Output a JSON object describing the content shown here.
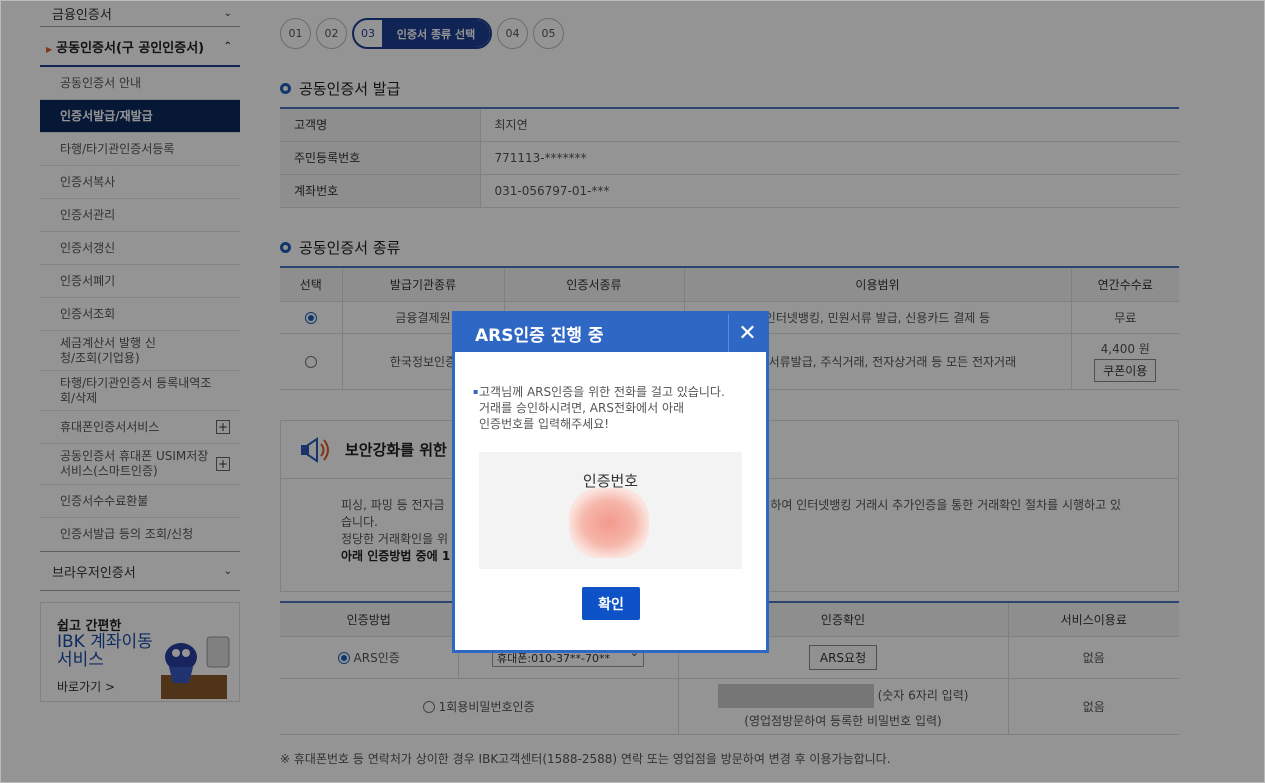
{
  "sidebar": {
    "top_item": "금융인증서",
    "group": "공동인증서(구 공인인증서)",
    "items": [
      {
        "label": "공동인증서 안내"
      },
      {
        "label": "인증서발급/재발급"
      },
      {
        "label": "타행/타기관인증서등록"
      },
      {
        "label": "인증서복사"
      },
      {
        "label": "인증서관리"
      },
      {
        "label": "인증서갱신"
      },
      {
        "label": "인증서폐기"
      },
      {
        "label": "인증서조회"
      },
      {
        "label": "세금계산서 발행 신청/조회(기업용)"
      },
      {
        "label": "타행/타기관인증서 등록내역조회/삭제"
      },
      {
        "label": "휴대폰인증서서비스"
      },
      {
        "label": "공동인증서 휴대폰 USIM저장서비스(스마트인증)"
      },
      {
        "label": "인증서수수료환불"
      },
      {
        "label": "인증서발급 등의 조회/신청"
      }
    ],
    "browser": "브라우저인증서",
    "banner": {
      "line1": "쉽고 간편한",
      "line2": "IBK 계좌이동 서비스",
      "link": "바로가기 >"
    }
  },
  "steps": [
    "01",
    "02",
    "03",
    "04",
    "05"
  ],
  "current_step_label": "인증서 종류 선택",
  "issue": {
    "title": "공동인증서 발급",
    "rows": [
      {
        "label": "고객명",
        "value": "최지연"
      },
      {
        "label": "주민등록번호",
        "value": "771113-*******"
      },
      {
        "label": "계좌번호",
        "value": "031-056797-01-***"
      }
    ]
  },
  "types": {
    "title": "공동인증서 종류",
    "headers": [
      "선택",
      "발급기관종류",
      "인증서종류",
      "이용범위",
      "연간수수료"
    ],
    "rows": [
      {
        "org": "금융결제원",
        "cert": "",
        "scope": "인터넷뱅킹, 민원서류 발급, 신용카드 결제 등",
        "fee": "무료"
      },
      {
        "org": "한국정보인증",
        "cert": "",
        "scope": ", 민원서류발급, 주식거래, 전자상거래 등 모든 전자거래",
        "fee": "4,400 원"
      }
    ],
    "coupon": "쿠폰이용"
  },
  "security": {
    "title": "보안강화를 위한",
    "p1": "피싱, 파밍 등 전자금",
    "p1b": "하여 인터넷뱅킹 거래시 추가인증을 통한 거래확인 절차를 시행하고 있",
    "p2": "습니다.",
    "p3": "정당한 거래확인을 위",
    "p4": "아래 인증방법 중에 1"
  },
  "auth": {
    "headers": [
      "인증방법",
      "",
      "인증확인",
      "서비스이용료"
    ],
    "ars_label": "ARS인증",
    "phone_select": "휴대폰:010-37**-70**",
    "ars_button": "ARS요청",
    "fee1": "없음",
    "otp_label": "1회용비밀번호인증",
    "otp_hint": "(숫자 6자리 입력)",
    "otp_hint2": "(영업점방문하여 등록한 비밀번호 입력)",
    "fee2": "없음"
  },
  "footnote": "※ 휴대폰번호 등 연락처가 상이한 경우 IBK고객센터(1588-2588) 연락 또는 영업점을 방문하여 변경 후 이용가능합니다.",
  "modal": {
    "title": "ARS인증 진행 중",
    "message1": "고객님께 ARS인증을 위한 전화를 걸고 있습니다.",
    "message2": "거래를 승인하시려면, ARS전화에서 아래",
    "message3": "인증번호를 입력해주세요!",
    "code_label": "인증번호",
    "ok": "확인"
  }
}
